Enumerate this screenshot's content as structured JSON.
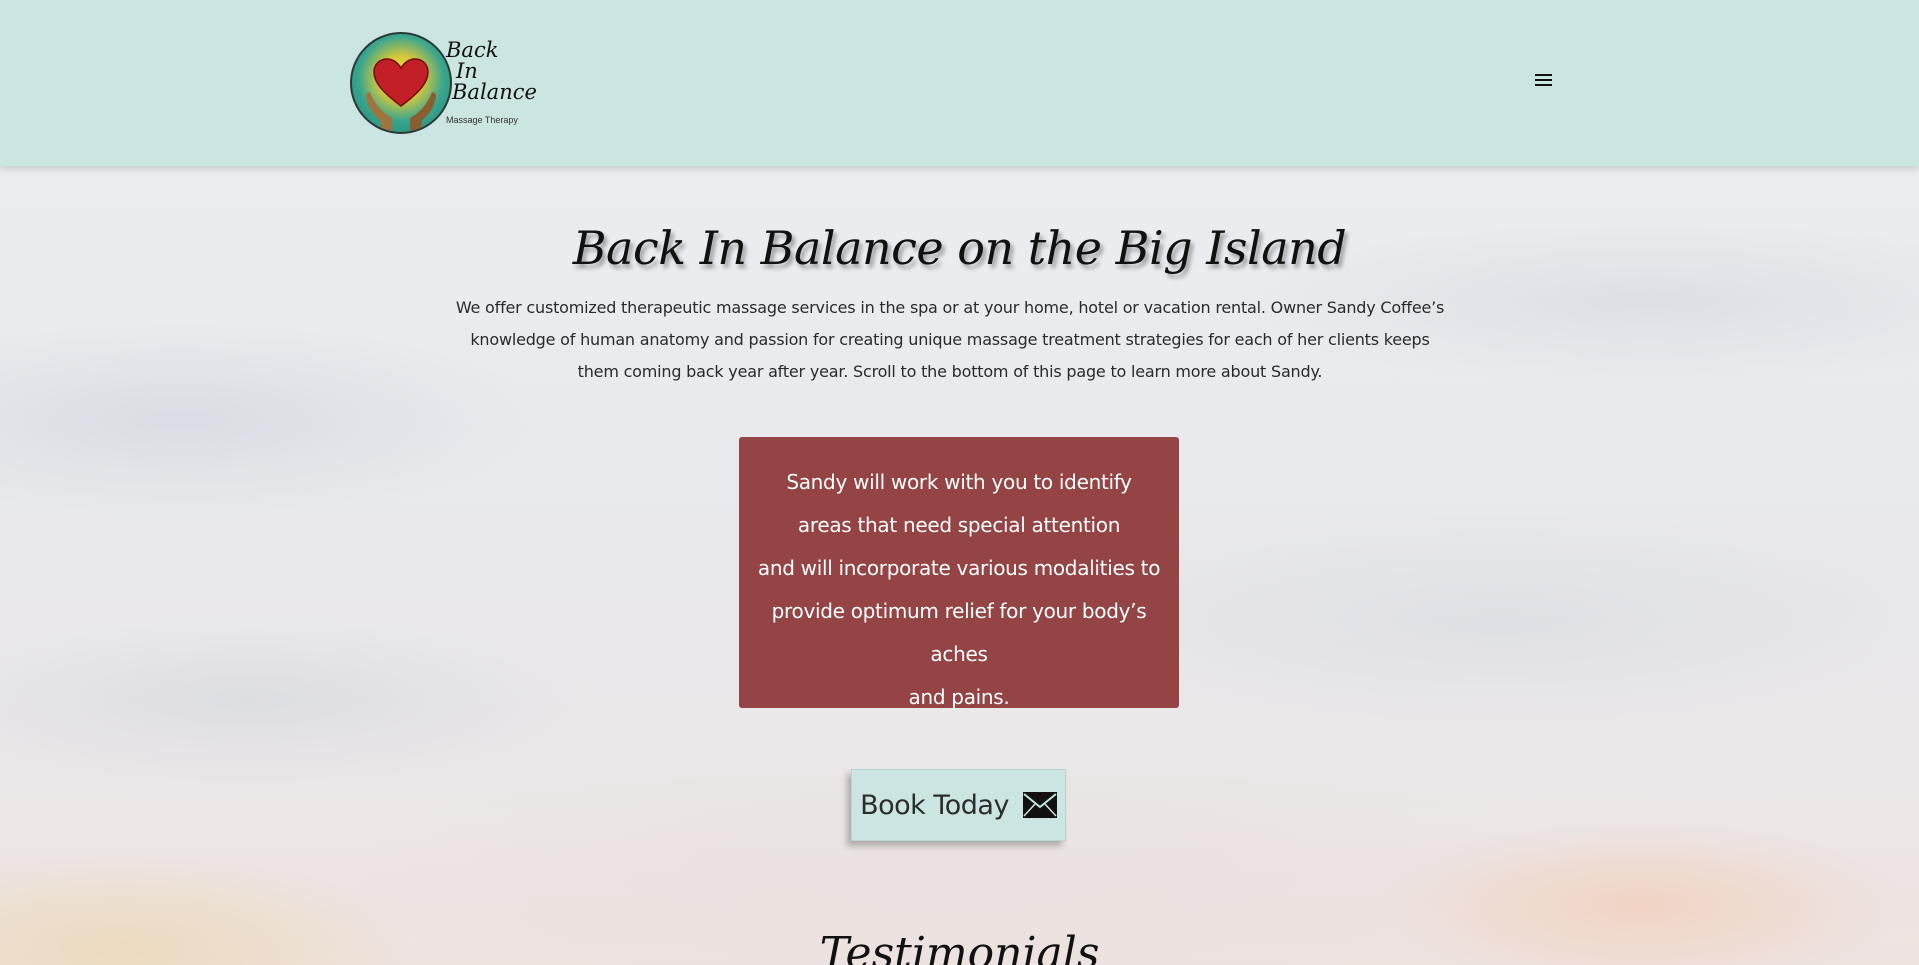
{
  "header": {
    "logo": {
      "line1": "Back",
      "line2": "In",
      "line3": "Balance",
      "subtitle": "Massage Therapy"
    },
    "menu_icon": "hamburger-menu-icon"
  },
  "hero": {
    "title": "Back In Balance on the Big Island",
    "intro": "We offer customized therapeutic massage services in the spa or at your home, hotel or vacation rental.  Owner Sandy Coffee’s knowledge of  human anatomy and  passion for creating unique massage treatment strategies for each of her clients keeps them coming back year after year. Scroll to the bottom of this page to learn more about Sandy."
  },
  "callout": {
    "lines": [
      "Sandy will work with you to identify",
      "areas that need special attention",
      "and will incorporate various modalities to",
      "provide optimum relief for your body’s aches",
      "and pains."
    ]
  },
  "cta": {
    "label": "Book Today",
    "icon": "envelope-icon"
  },
  "testimonials": {
    "title": "Testimonials"
  },
  "colors": {
    "header_bg": "#cbe5e2",
    "callout_bg": "#944445",
    "button_bg": "#cbe5e2"
  }
}
